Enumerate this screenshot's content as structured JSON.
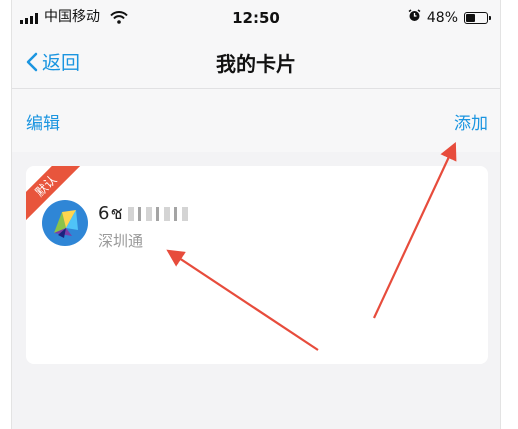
{
  "status_bar": {
    "carrier": "中国移动",
    "time": "12:50",
    "battery": "48%",
    "battery_level": 0.48,
    "icons": [
      "signal-bars-icon",
      "wifi-icon",
      "alarm-clock-icon",
      "battery-icon"
    ]
  },
  "nav": {
    "back_label": "返回",
    "title": "我的卡片"
  },
  "toolbar": {
    "edit_label": "编辑",
    "add_label": "添加"
  },
  "card": {
    "badge": "默认",
    "number": "6ช",
    "name": "深圳通",
    "logo_icon": "shenzhen-tong-logo-icon"
  },
  "colors": {
    "accent": "#1b95e0",
    "badge": "#e8553c",
    "annotation_arrow": "#e74c3c"
  }
}
